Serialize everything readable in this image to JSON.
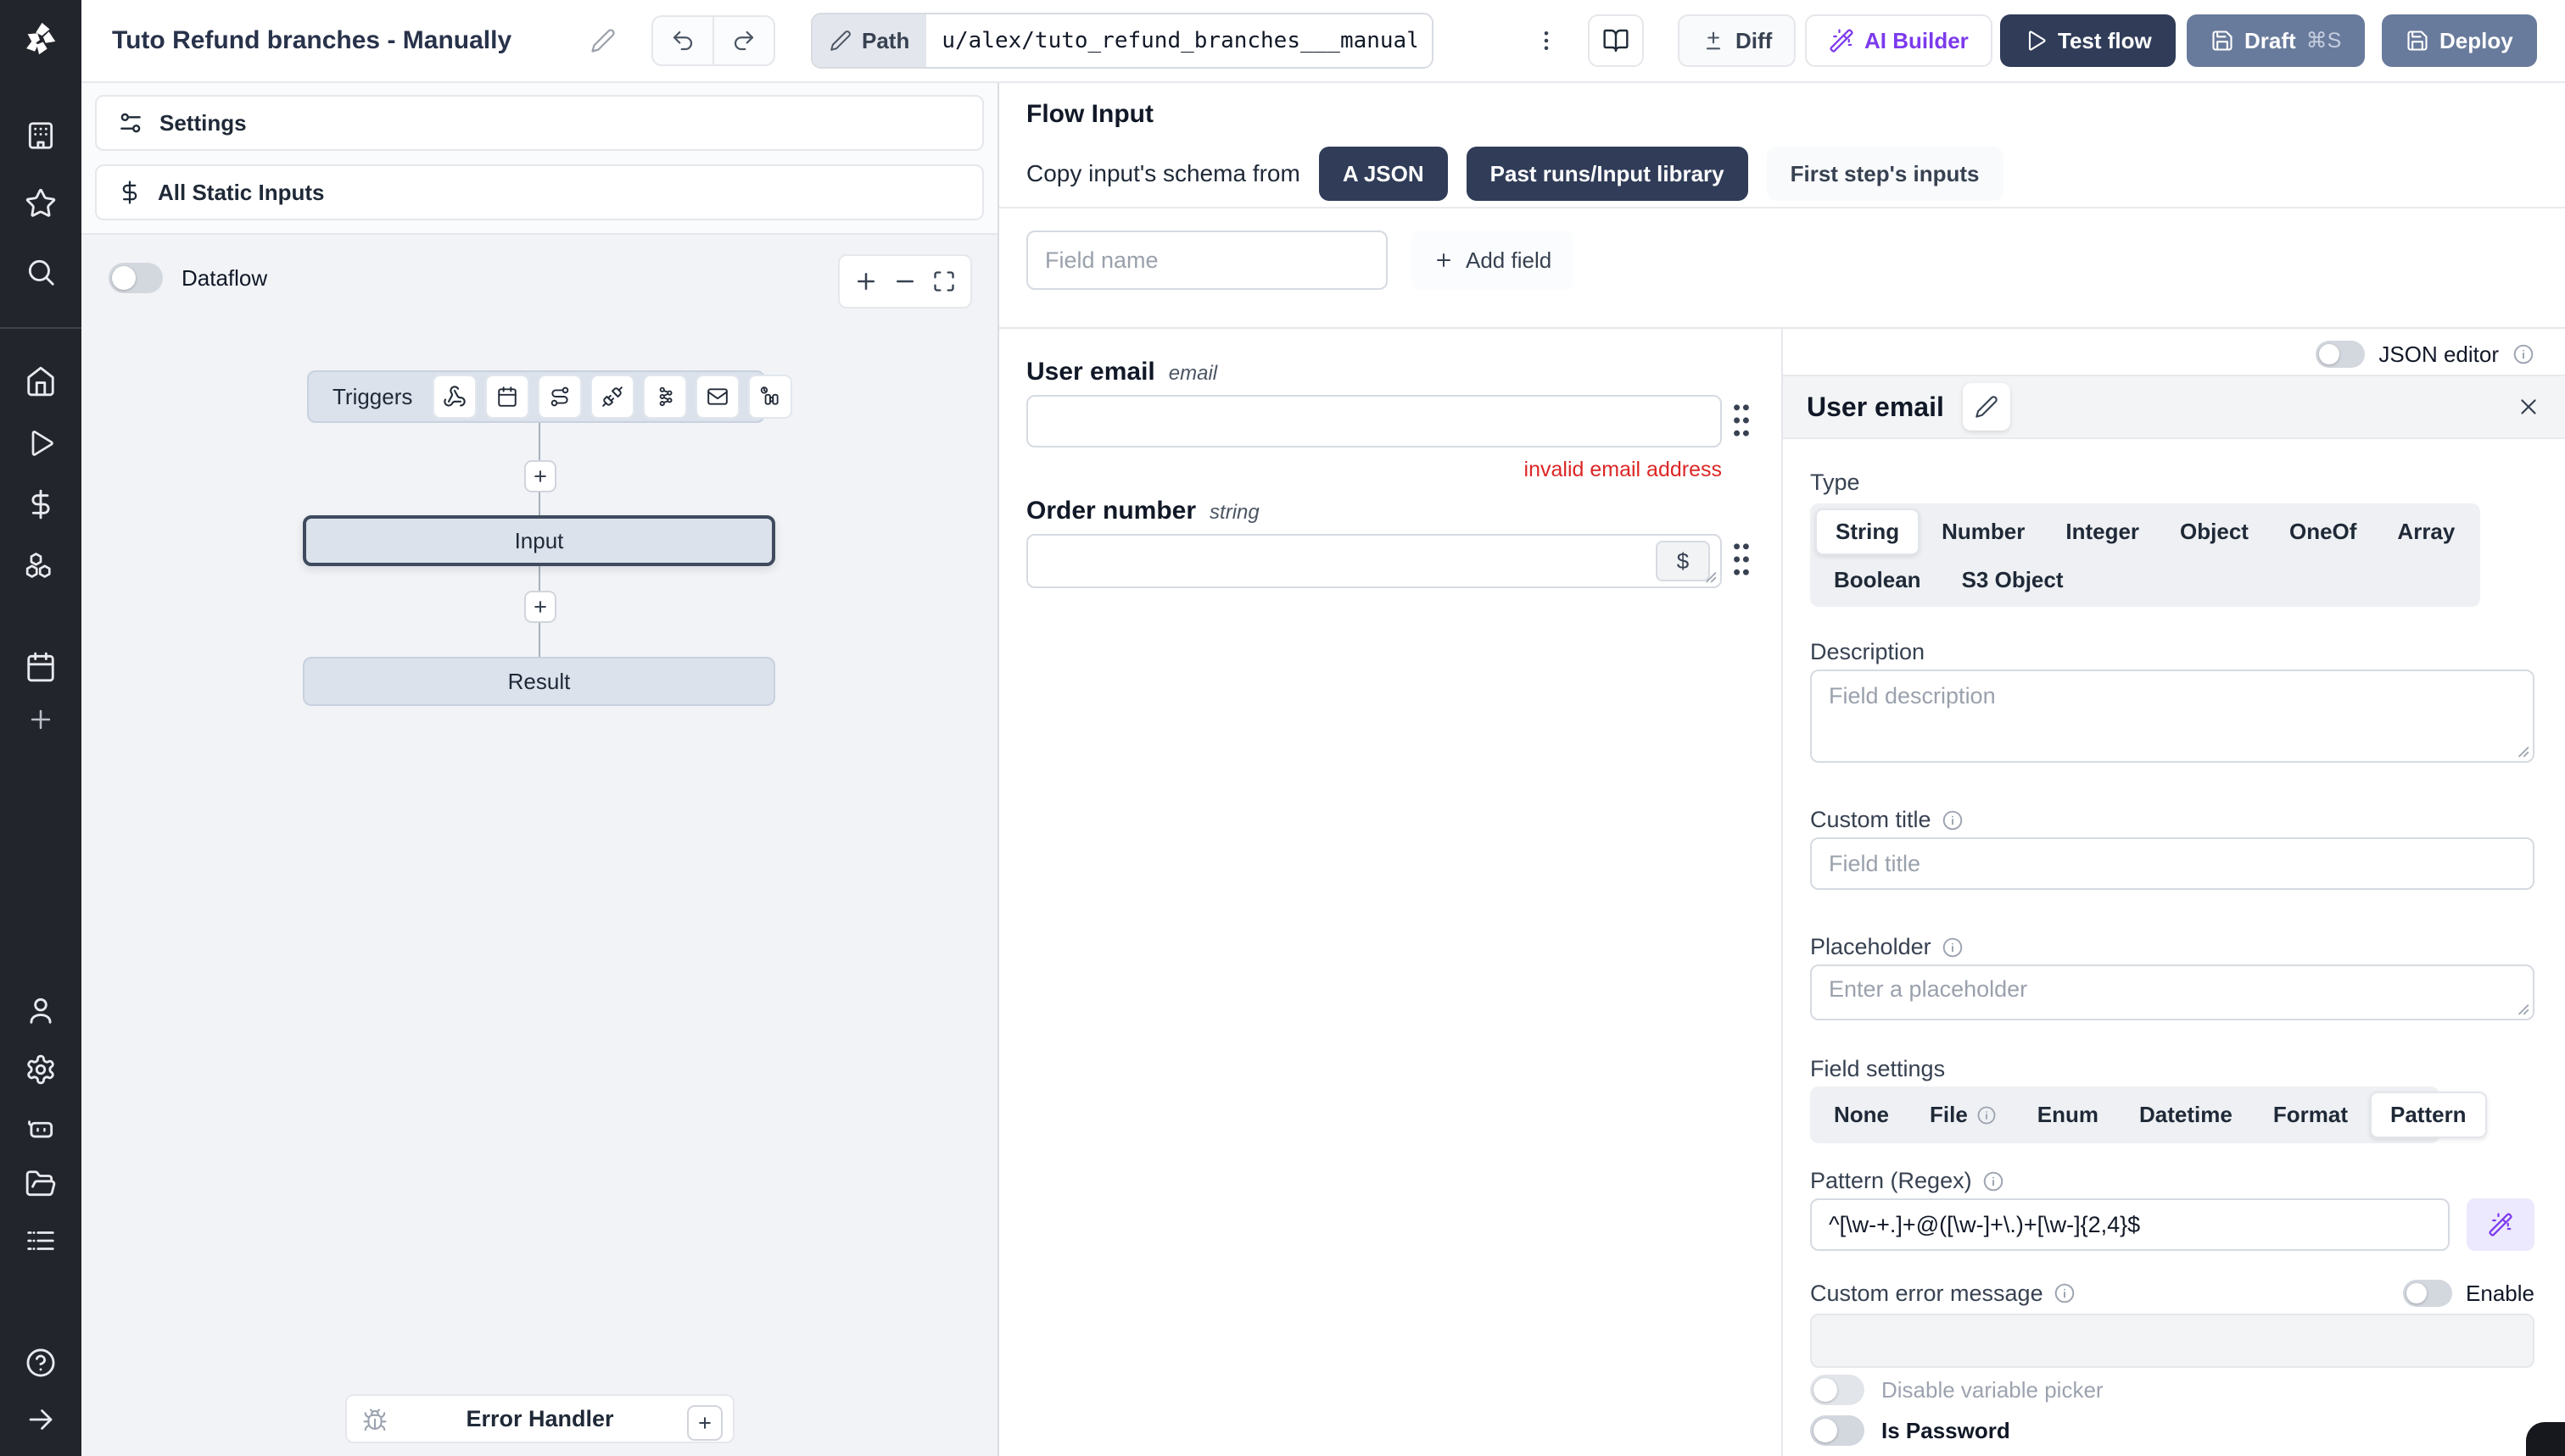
{
  "topbar": {
    "title": "Tuto Refund branches - Manually",
    "path_label": "Path",
    "path_value": "u/alex/tuto_refund_branches___manually",
    "diff_label": "Diff",
    "ai_builder_label": "AI Builder",
    "test_flow_label": "Test flow",
    "draft_label": "Draft",
    "draft_shortcut": "⌘S",
    "deploy_label": "Deploy"
  },
  "left_panel": {
    "settings_label": "Settings",
    "static_inputs_label": "All Static Inputs",
    "dataflow_label": "Dataflow",
    "graph": {
      "triggers_label": "Triggers",
      "input_label": "Input",
      "result_label": "Result",
      "error_handler_label": "Error Handler"
    }
  },
  "flow_input": {
    "title": "Flow Input",
    "copy_schema_label": "Copy input's schema from",
    "copy_options": [
      "A JSON",
      "Past runs/Input library",
      "First step's inputs"
    ],
    "field_name_placeholder": "Field name",
    "add_field_label": "Add field",
    "fields": [
      {
        "label": "User email",
        "type": "email",
        "error": "invalid email address"
      },
      {
        "label": "Order number",
        "type": "string",
        "variable_button": "$"
      }
    ]
  },
  "editor": {
    "json_editor_label": "JSON editor",
    "field_title": "User email",
    "type_label": "Type",
    "types": [
      "String",
      "Number",
      "Integer",
      "Object",
      "OneOf",
      "Array",
      "Boolean",
      "S3 Object"
    ],
    "selected_type": "String",
    "description_label": "Description",
    "description_placeholder": "Field description",
    "custom_title_label": "Custom title",
    "custom_title_placeholder": "Field title",
    "placeholder_label": "Placeholder",
    "placeholder_placeholder": "Enter a placeholder",
    "field_settings_label": "Field settings",
    "settings_options": [
      "None",
      "File",
      "Enum",
      "Datetime",
      "Format",
      "Pattern"
    ],
    "selected_setting": "Pattern",
    "pattern_label": "Pattern (Regex)",
    "pattern_value": "^[\\w-+.]+@([\\w-]+\\.)+[\\w-]{2,4}$",
    "custom_error_label": "Custom error message",
    "enable_label": "Enable",
    "disable_variable_picker_label": "Disable variable picker",
    "is_password_label": "Is Password"
  },
  "colors": {
    "sidebar": "#23252c",
    "navy": "#303c58",
    "slate": "#697b9c",
    "purple": "#7c3aed",
    "purple_bg": "#ece8fd",
    "error": "#dc2626",
    "canvas": "#f1f3f6",
    "node": "#dbe2ec",
    "node_selected_border": "#3f4a5d",
    "seg": "#eef0f3"
  }
}
